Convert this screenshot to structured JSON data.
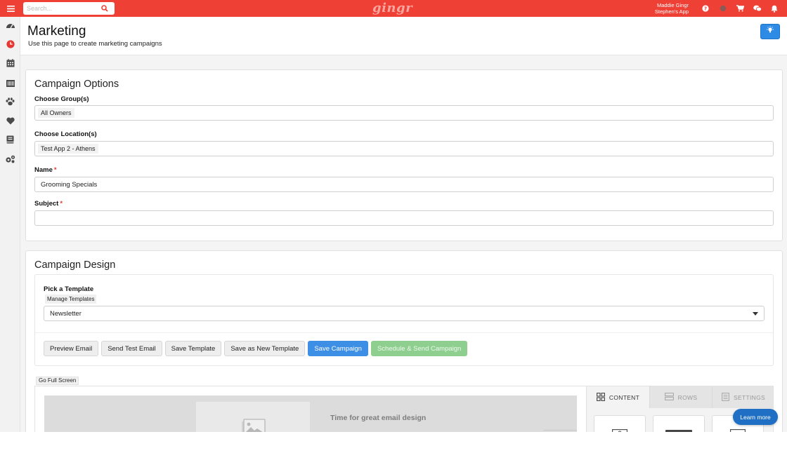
{
  "topbar": {
    "search_placeholder": "Search...",
    "logo": "gingr",
    "user_name": "Maddie Gingr",
    "app_name": "Stephen's App"
  },
  "page": {
    "title": "Marketing",
    "subtitle": "Use this page to create marketing campaigns"
  },
  "campaign_options": {
    "title": "Campaign Options",
    "groups_label": "Choose Group(s)",
    "groups_value": "All Owners",
    "location_label": "Choose Location(s)",
    "location_value": "Test App 2 - Athens",
    "name_label": "Name",
    "name_value": "Grooming Specials",
    "subject_label": "Subject",
    "subject_value": "",
    "required_mark": "*"
  },
  "campaign_design": {
    "title": "Campaign Design",
    "template_label": "Pick a Template",
    "manage_templates": "Manage Templates",
    "template_selected": "Newsletter",
    "buttons": {
      "preview": "Preview Email",
      "send_test": "Send Test Email",
      "save_template": "Save Template",
      "save_new_template": "Save as New Template",
      "save_campaign": "Save Campaign",
      "schedule_send": "Schedule & Send Campaign"
    },
    "full_screen": "Go Full Screen",
    "canvas_text": "Time for great email design",
    "tabs": {
      "content": "CONTENT",
      "rows": "ROWS",
      "settings": "SETTINGS"
    }
  },
  "learn_more": "Learn more",
  "colors": {
    "topbar": "#ef4036",
    "primary": "#3d8fe6",
    "success": "#8ecf8f",
    "tip_button": "#2d8ae5",
    "learn_more": "#1f6fc5"
  }
}
